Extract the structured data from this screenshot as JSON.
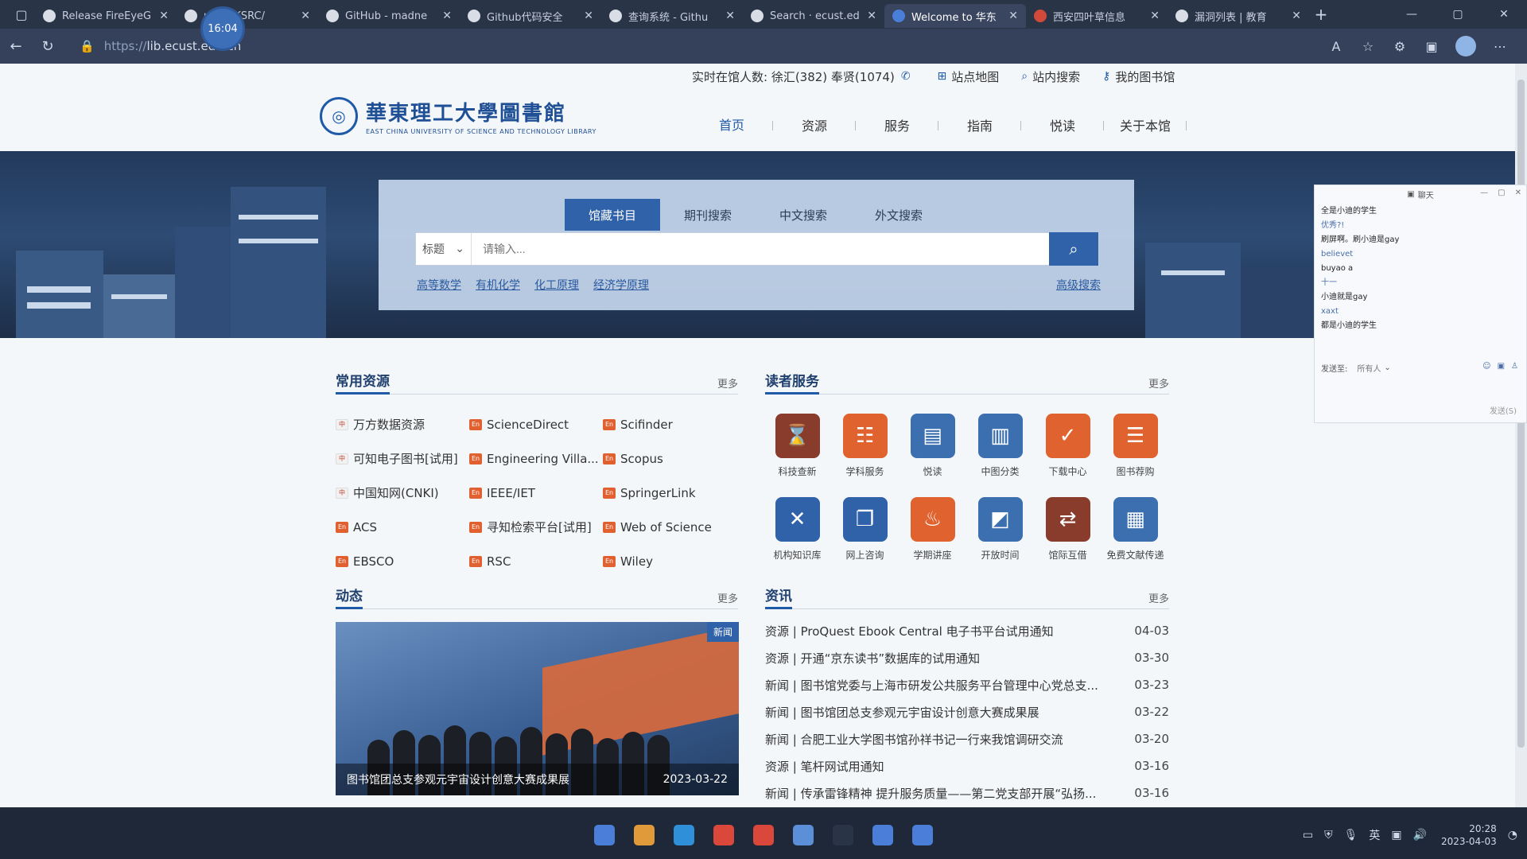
{
  "browser": {
    "tabs": [
      {
        "title": "Release FireEyeG",
        "fav": "github-icon"
      },
      {
        "title": "ub - VKSRC/",
        "fav": "github-icon"
      },
      {
        "title": "GitHub - madne",
        "fav": "github-icon"
      },
      {
        "title": "Github代码安全",
        "fav": "wordpress-icon"
      },
      {
        "title": "查询系统 - Githu",
        "fav": "app-icon"
      },
      {
        "title": "Search · ecust.ed",
        "fav": "github-icon"
      },
      {
        "title": "Welcome to 华东",
        "fav": "site-icon"
      },
      {
        "title": "西安四叶草信息",
        "fav": "clover-icon"
      },
      {
        "title": "漏洞列表 | 教育",
        "fav": "globe-icon"
      }
    ],
    "recording_time": "16:04",
    "url_proto": "https://",
    "url_host": "lib.ecust.edu.cn"
  },
  "header": {
    "live_count_label": "实时在馆人数: 徐汇(382) 奉贤(1074)",
    "sitemap": "站点地图",
    "site_search": "站内搜索",
    "my_library": "我的图书馆",
    "logo_cn": "華東理工大學圖書館",
    "logo_en": "EAST CHINA UNIVERSITY OF SCIENCE AND TECHNOLOGY LIBRARY"
  },
  "nav": [
    "首页",
    "资源",
    "服务",
    "指南",
    "悦读",
    "关于本馆"
  ],
  "search": {
    "tabs": [
      "馆藏书目",
      "期刊搜索",
      "中文搜索",
      "外文搜索"
    ],
    "field": "标题",
    "placeholder": "请输入...",
    "quick": [
      "高等数学",
      "有机化学",
      "化工原理",
      "经济学原理"
    ],
    "advanced": "高级搜索"
  },
  "resources": {
    "title": "常用资源",
    "more": "更多",
    "rows": [
      [
        {
          "t": "万方数据资源",
          "cn": true
        },
        {
          "t": "ScienceDirect"
        },
        {
          "t": "Scifinder"
        }
      ],
      [
        {
          "t": "可知电子图书[试用]",
          "cn": true
        },
        {
          "t": "Engineering Villa..."
        },
        {
          "t": "Scopus"
        }
      ],
      [
        {
          "t": "中国知网(CNKI)",
          "cn": true
        },
        {
          "t": "IEEE/IET"
        },
        {
          "t": "SpringerLink"
        }
      ],
      [
        {
          "t": "ACS"
        },
        {
          "t": "寻知检索平台[试用]"
        },
        {
          "t": "Web of Science"
        }
      ],
      [
        {
          "t": "EBSCO"
        },
        {
          "t": "RSC"
        },
        {
          "t": "Wiley"
        }
      ]
    ]
  },
  "services": {
    "title": "读者服务",
    "more": "更多",
    "items": [
      {
        "label": "科技查新",
        "color": "#8a3c2c",
        "icon": "hourglass-icon",
        "glyph": "⌛"
      },
      {
        "label": "学科服务",
        "color": "#e0622e",
        "icon": "hierarchy-icon",
        "glyph": "☷"
      },
      {
        "label": "悦读",
        "color": "#3b6fb0",
        "icon": "book-icon",
        "glyph": "▤"
      },
      {
        "label": "中图分类",
        "color": "#3b6fb0",
        "icon": "books-icon",
        "glyph": "▥"
      },
      {
        "label": "下载中心",
        "color": "#e0622e",
        "icon": "calendar-check-icon",
        "glyph": "✓"
      },
      {
        "label": "图书荐购",
        "color": "#e0622e",
        "icon": "list-icon",
        "glyph": "☰"
      },
      {
        "label": "机构知识库",
        "color": "#2f62a8",
        "icon": "tools-icon",
        "glyph": "✕"
      },
      {
        "label": "网上咨询",
        "color": "#2f62a8",
        "icon": "chat-icon",
        "glyph": "❐"
      },
      {
        "label": "学期讲座",
        "color": "#e0622e",
        "icon": "lecture-icon",
        "glyph": "♨"
      },
      {
        "label": "开放时间",
        "color": "#3b6fb0",
        "icon": "clock-board-icon",
        "glyph": "◩"
      },
      {
        "label": "馆际互借",
        "color": "#8a3c2c",
        "icon": "exchange-icon",
        "glyph": "⇄"
      },
      {
        "label": "免费文献传递",
        "color": "#3b6fb0",
        "icon": "document-transfer-icon",
        "glyph": "▦"
      }
    ]
  },
  "dynamic": {
    "title": "动态",
    "more": "更多",
    "tag": "新闻",
    "caption": "图书馆团总支参观元宇宙设计创意大赛成果展",
    "date": "2023-03-22"
  },
  "news": {
    "title": "资讯",
    "more": "更多",
    "items": [
      {
        "t": "资源 | ProQuest Ebook Central 电子书平台试用通知",
        "d": "04-03"
      },
      {
        "t": "资源 | 开通“京东读书”数据库的试用通知",
        "d": "03-30"
      },
      {
        "t": "新闻 | 图书馆党委与上海市研发公共服务平台管理中心党总支...",
        "d": "03-23"
      },
      {
        "t": "新闻 | 图书馆团总支参观元宇宙设计创意大赛成果展",
        "d": "03-22"
      },
      {
        "t": "新闻 | 合肥工业大学图书馆孙祥书记一行来我馆调研交流",
        "d": "03-20"
      },
      {
        "t": "资源 | 笔杆网试用通知",
        "d": "03-16"
      },
      {
        "t": "新闻 | 传承雷锋精神 提升服务质量——第二党支部开展“弘扬...",
        "d": "03-16"
      }
    ]
  },
  "chat": {
    "title": "聊天",
    "messages": [
      {
        "t": "全是小迪的学生"
      },
      {
        "t": "优秀?!",
        "name": true
      },
      {
        "t": "刷屏啊。刷小迪是gay"
      },
      {
        "t": "believet",
        "name": true
      },
      {
        "t": "buyao a"
      },
      {
        "t": "十一",
        "name": true
      },
      {
        "t": "小迪就是gay"
      },
      {
        "t": "xaxt",
        "name": true
      },
      {
        "t": "都是小迪的学生"
      }
    ],
    "send_to": "发送至:",
    "recipient": "所有人",
    "send": "发送(S)"
  },
  "taskbar": {
    "time": "20:28",
    "date": "2023-04-03",
    "lang": "英",
    "apps": [
      "#4a7ed8",
      "#e09a3a",
      "#2f8fd8",
      "#d9483b",
      "#d9483b",
      "#5b8fd8",
      "#2a3447",
      "#4a7ed8",
      "#4a7ed8"
    ]
  }
}
